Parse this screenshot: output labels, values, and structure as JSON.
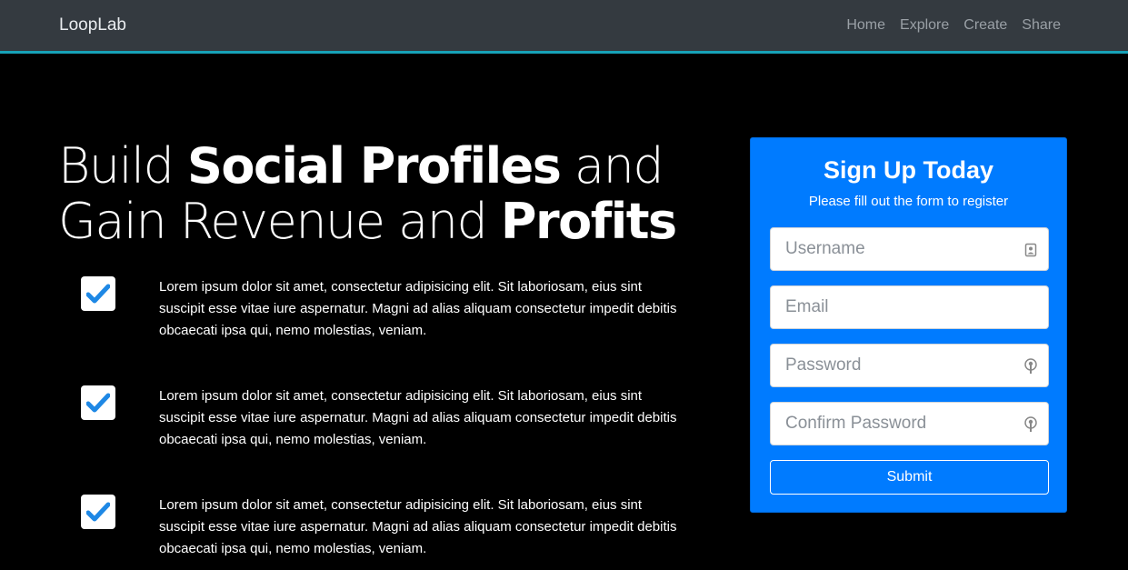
{
  "navbar": {
    "brand": "LoopLab",
    "links": [
      "Home",
      "Explore",
      "Create",
      "Share"
    ]
  },
  "hero": {
    "headline_parts": [
      "Build ",
      "Social Profiles",
      " and Gain Revenue and ",
      "Profits"
    ]
  },
  "features": [
    {
      "icon": "check-icon",
      "text": "Lorem ipsum dolor sit amet, consectetur adipisicing elit. Sit laboriosam, eius sint suscipit esse vitae iure aspernatur. Magni ad alias aliquam consectetur impedit debitis obcaecati ipsa qui, nemo molestias, veniam."
    },
    {
      "icon": "check-icon",
      "text": "Lorem ipsum dolor sit amet, consectetur adipisicing elit. Sit laboriosam, eius sint suscipit esse vitae iure aspernatur. Magni ad alias aliquam consectetur impedit debitis obcaecati ipsa qui, nemo molestias, veniam."
    },
    {
      "icon": "check-icon",
      "text": "Lorem ipsum dolor sit amet, consectetur adipisicing elit. Sit laboriosam, eius sint suscipit esse vitae iure aspernatur. Magni ad alias aliquam consectetur impedit debitis obcaecati ipsa qui, nemo molestias, veniam."
    }
  ],
  "signup": {
    "title": "Sign Up Today",
    "subtitle": "Please fill out the form to register",
    "fields": [
      {
        "placeholder": "Username",
        "value": "",
        "icon": "contact-card-icon"
      },
      {
        "placeholder": "Email",
        "value": "",
        "icon": ""
      },
      {
        "placeholder": "Password",
        "value": "",
        "icon": "key-icon"
      },
      {
        "placeholder": "Confirm Password",
        "value": "",
        "icon": "key-icon"
      }
    ],
    "submit_label": "Submit"
  },
  "colors": {
    "navbar_bg": "#343a40",
    "navbar_accent": "#17a2b8",
    "card_bg": "#007bff",
    "check_color": "#1e88e5"
  }
}
